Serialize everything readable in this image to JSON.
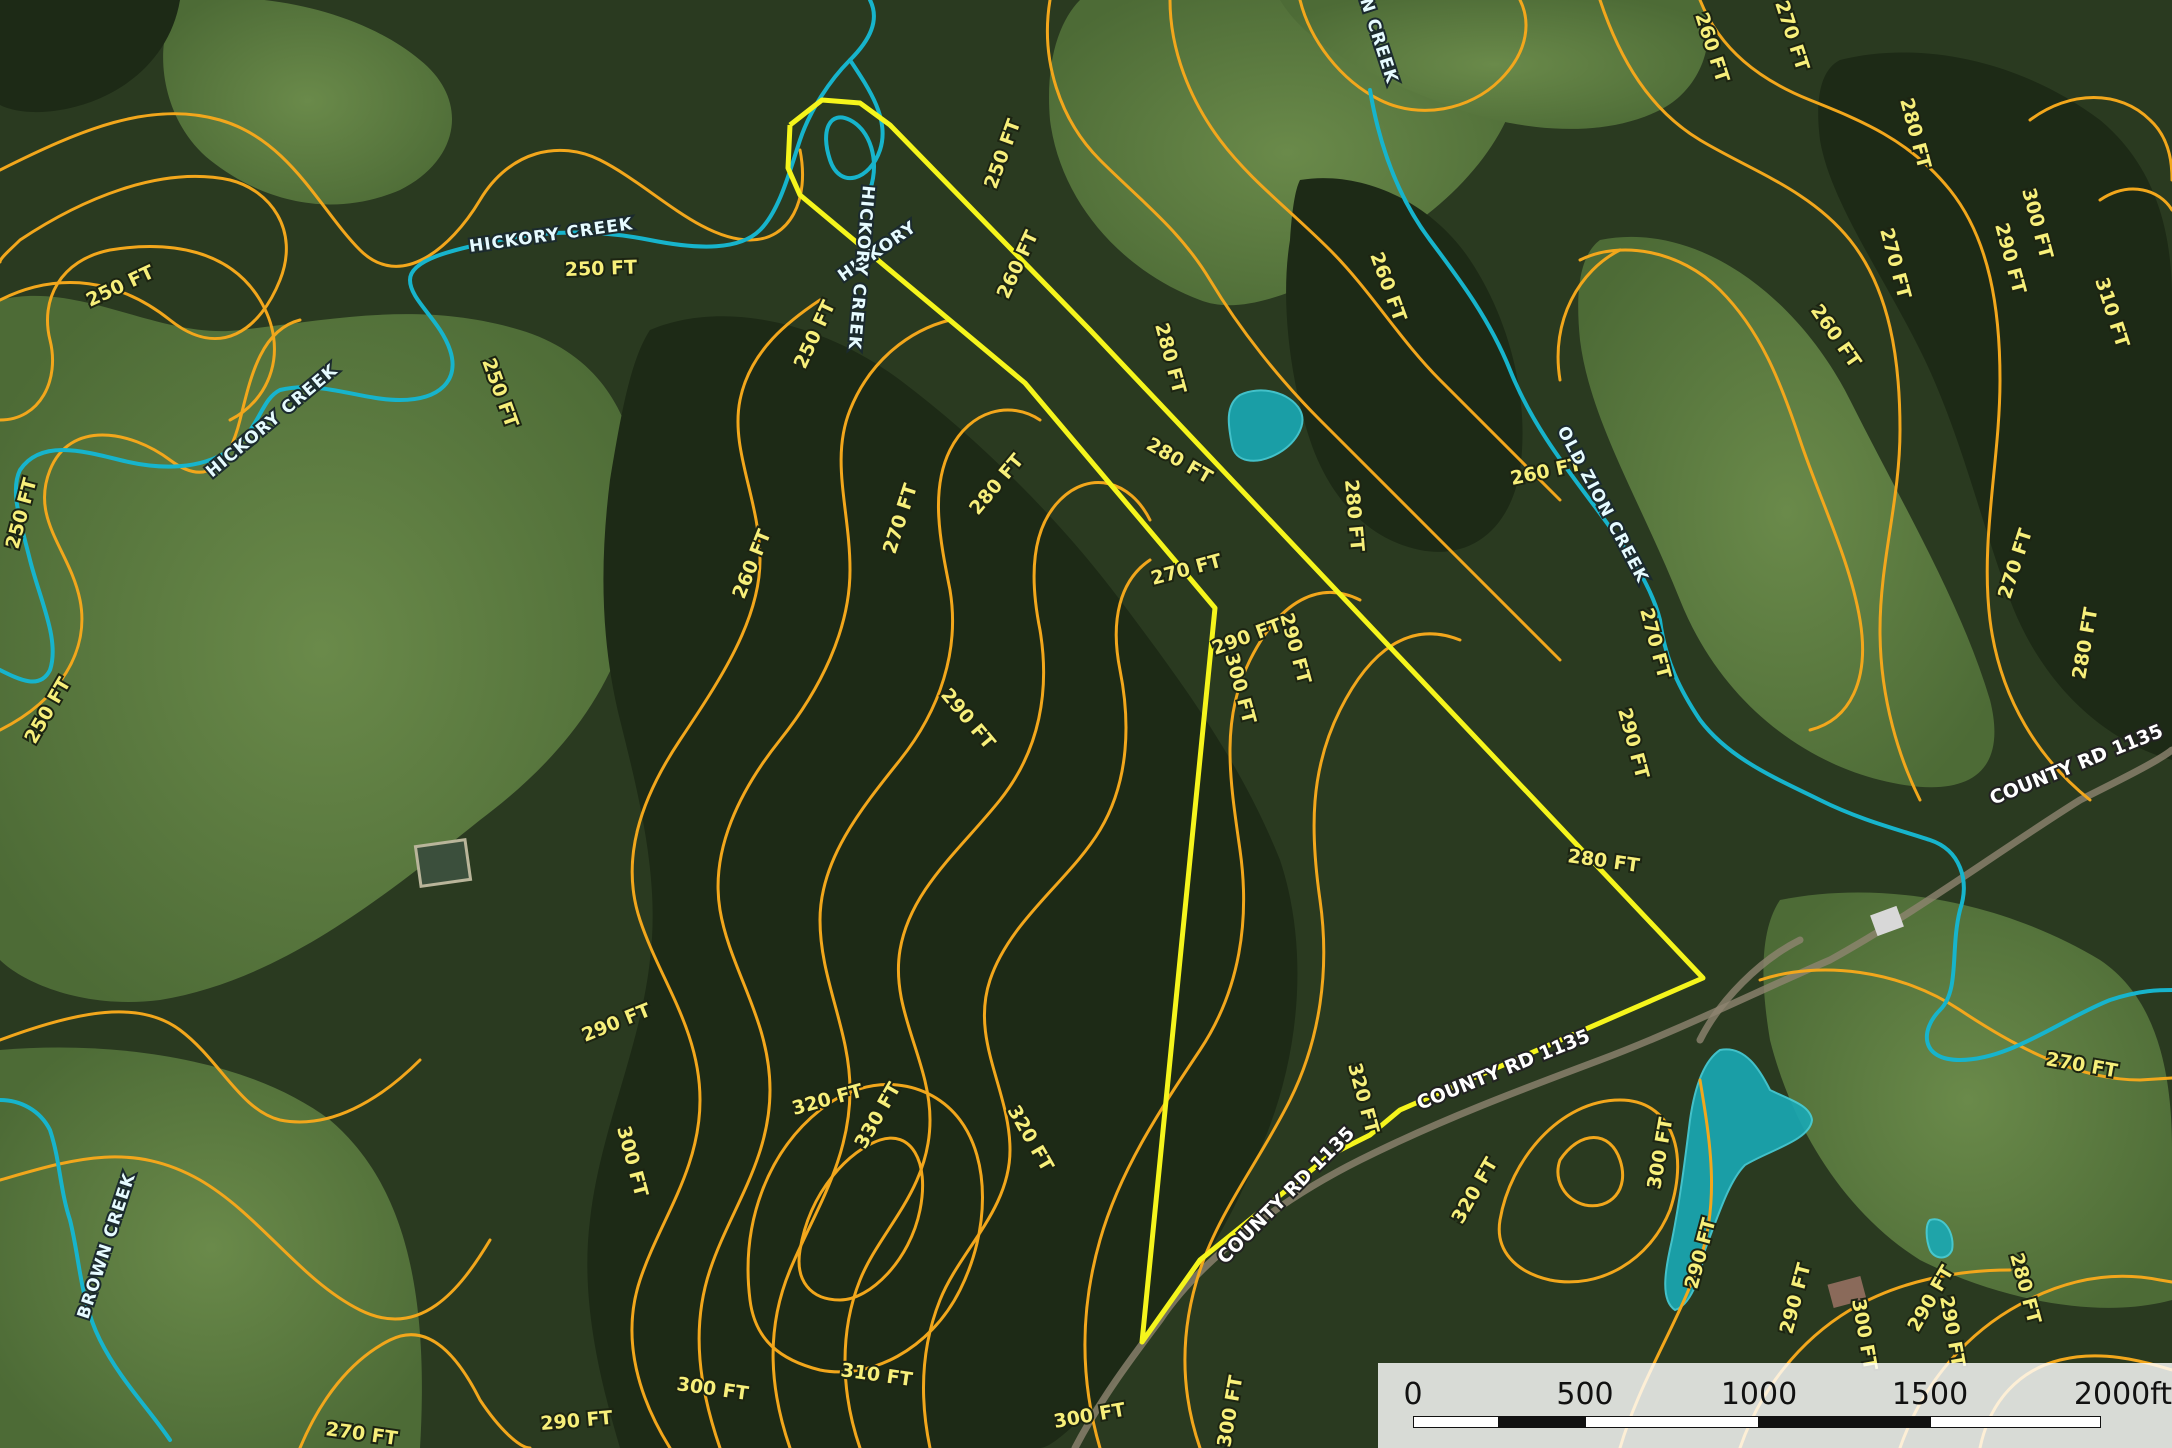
{
  "map": {
    "colors": {
      "contour": "#f2a71c",
      "creek": "#17b4cc",
      "boundary": "#f5f51c",
      "pasture": "#5a7a3f",
      "forest": "#1f2e18"
    },
    "contour_labels": [
      "250 FT",
      "250 FT",
      "250 FT",
      "250 FT",
      "250 FT",
      "250 FT",
      "250 FT",
      "260 FT",
      "260 FT",
      "260 FT",
      "260 FT",
      "260 FT",
      "260 FT",
      "270 FT",
      "270 FT",
      "270 FT",
      "270 FT",
      "270 FT",
      "270 FT",
      "270 FT",
      "270 FT",
      "280 FT",
      "280 FT",
      "280 FT",
      "280 FT",
      "280 FT",
      "280 FT",
      "280 FT",
      "280 FT",
      "290 FT",
      "290 FT",
      "290 FT",
      "290 FT",
      "290 FT",
      "290 FT",
      "290 FT",
      "290 FT",
      "290 FT",
      "290 FT",
      "290 FT",
      "300 FT",
      "300 FT",
      "300 FT",
      "300 FT",
      "300 FT",
      "300 FT",
      "300 FT",
      "300 FT",
      "310 FT",
      "310 FT",
      "320 FT",
      "320 FT",
      "320 FT",
      "320 FT",
      "330 FT"
    ],
    "creek_labels": [
      "HICKORY CREEK",
      "HICKORY CREEK",
      "HICKORY",
      "HICKORY CREEK",
      "OLD ZION CREEK",
      "N CREEK",
      "BROWN CREEK"
    ],
    "road_labels": [
      "COUNTY RD 1135",
      "COUNTY RD 1135",
      "COUNTY RD 1135"
    ]
  },
  "scale": {
    "ticks": [
      "0",
      "500",
      "1000",
      "1500",
      "2000ft"
    ]
  }
}
